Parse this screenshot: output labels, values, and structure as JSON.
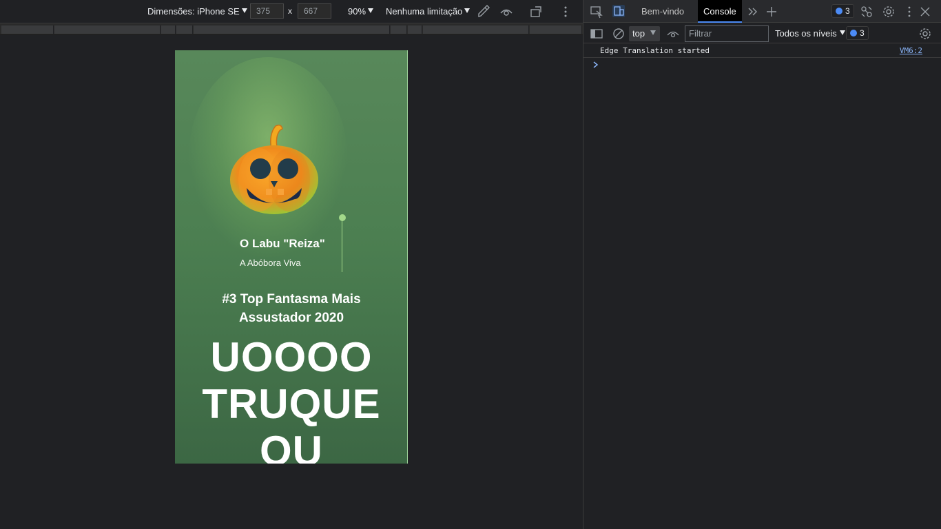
{
  "emulation_toolbar": {
    "dimensions_label": "Dimensões: iPhone SE",
    "width_value": "375",
    "times": "x",
    "height_value": "667",
    "zoom": "90%",
    "throttling": "Nenhuma limitação"
  },
  "page": {
    "character_name": "O Labu \"Reiza\"",
    "character_subtitle": "A Abóbora Viva",
    "rank_text": "#3 Top Fantasma Mais Assustador 2020",
    "headline_lines": [
      "UOOOO",
      "TRUQUE",
      "OU"
    ],
    "colors": {
      "background": "#4c7f51",
      "accent": "#a3d98a",
      "text": "#ffffff"
    }
  },
  "devtools": {
    "tabs": [
      {
        "label": "Bem-vindo",
        "active": false
      },
      {
        "label": "Console",
        "active": true
      }
    ],
    "issues_badge": "3",
    "console_toolbar": {
      "context": "top",
      "filter_placeholder": "Filtrar",
      "levels": "Todos os níveis",
      "issues_badge": "3"
    },
    "messages": [
      {
        "text": "Edge Translation started",
        "source": "VM6:2"
      }
    ]
  }
}
